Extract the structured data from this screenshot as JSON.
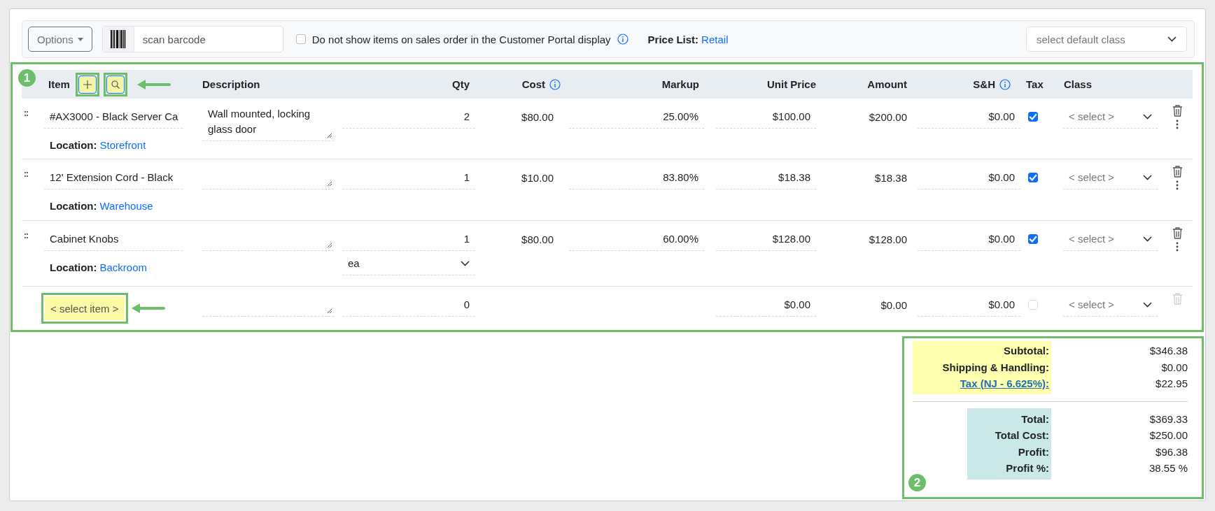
{
  "toolbar": {
    "options_button": "Options",
    "barcode_placeholder": "scan barcode",
    "portal_checkbox": {
      "label": "Do not show items on sales order in the Customer Portal display",
      "checked": false
    },
    "price_list": {
      "label": "Price List:",
      "value": "Retail"
    },
    "class_select": {
      "placeholder": "select default class"
    }
  },
  "table": {
    "columns": [
      {
        "label": "Item",
        "info": false
      },
      {
        "label": "Description",
        "info": false
      },
      {
        "label": "Qty",
        "info": false
      },
      {
        "label": "Cost",
        "info": true
      },
      {
        "label": "Markup",
        "info": false
      },
      {
        "label": "Unit Price",
        "info": false
      },
      {
        "label": "Amount",
        "info": false
      },
      {
        "label": "S&H",
        "info": true
      },
      {
        "label": "Tax",
        "info": false
      },
      {
        "label": "Class",
        "info": false
      }
    ],
    "rows": [
      {
        "kind": "line",
        "item": "#AX3000 - Black Server Ca",
        "description": "Wall mounted, locking glass door",
        "qty": "2",
        "cost": "$80.00",
        "markup": "25.00%",
        "unit_price": "$100.00",
        "amount": "$200.00",
        "sh": "$0.00",
        "tax": true,
        "class_placeholder": "< select >",
        "location_label": "Location:",
        "location": "Storefront"
      },
      {
        "kind": "line",
        "item": "12' Extension Cord - Black",
        "qty": "1",
        "cost": "$10.00",
        "markup": "83.80%",
        "unit_price": "$18.38",
        "amount": "$18.38",
        "sh": "$0.00",
        "tax": true,
        "class_placeholder": "< select >",
        "location_label": "Location:",
        "location": "Warehouse"
      },
      {
        "kind": "line",
        "item": "Cabinet Knobs",
        "qty": "1",
        "cost": "$80.00",
        "markup": "60.00%",
        "unit_price": "$128.00",
        "amount": "$128.00",
        "sh": "$0.00",
        "tax": true,
        "class_placeholder": "< select >",
        "location_label": "Location:",
        "location": "Backroom",
        "unit": "ea"
      },
      {
        "kind": "new",
        "item": "< select item >",
        "qty": "0",
        "unit_price": "$0.00",
        "amount": "$0.00",
        "sh": "$0.00",
        "tax": false,
        "class_placeholder": "< select >"
      }
    ]
  },
  "totals": {
    "groups": [
      {
        "kind": "charges",
        "lines": [
          {
            "label": "Subtotal:",
            "value": "$346.38",
            "link": false
          },
          {
            "label": "Shipping & Handling:",
            "value": "$0.00",
            "link": false
          },
          {
            "label": "Tax (NJ - 6.625%):",
            "value": "$22.95",
            "link": true
          }
        ]
      },
      {
        "kind": "profit",
        "lines": [
          {
            "label": "Total:",
            "value": "$369.33",
            "link": false
          },
          {
            "label": "Total Cost:",
            "value": "$250.00",
            "link": false
          },
          {
            "label": "Profit:",
            "value": "$96.38",
            "link": false
          },
          {
            "label": "Profit %:",
            "value": "38.55 %",
            "link": false
          }
        ]
      }
    ]
  },
  "callouts": [
    "1",
    "2"
  ]
}
